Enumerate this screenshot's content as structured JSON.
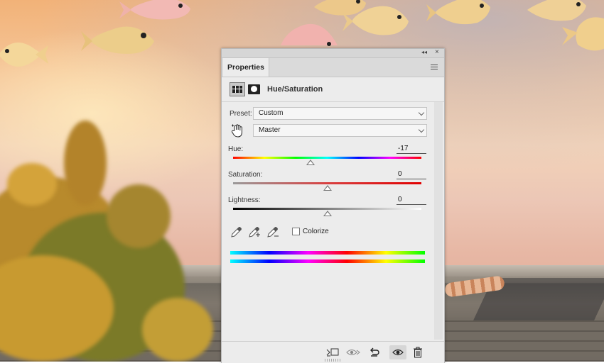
{
  "panel": {
    "tab_label": "Properties",
    "adjustment_title": "Hue/Saturation",
    "preset_label": "Preset:",
    "preset_value": "Custom",
    "channel_value": "Master",
    "colorize_label": "Colorize",
    "colorize_checked": false
  },
  "sliders": [
    {
      "label": "Hue:",
      "value": "-17",
      "position_percent": 41
    },
    {
      "label": "Saturation:",
      "value": "0",
      "position_percent": 50
    },
    {
      "label": "Lightness:",
      "value": "0",
      "position_percent": 50
    }
  ],
  "icons": {
    "collapse": "double-chevron-icon",
    "close": "close-icon",
    "panel_menu": "hamburger-menu-icon",
    "adjustment": "hue-saturation-adjustment-icon",
    "mask": "layer-mask-icon",
    "on_image": "targeted-adjustment-hand-icon",
    "eyedroppers": [
      "eyedropper-icon",
      "eyedropper-plus-icon",
      "eyedropper-minus-icon"
    ],
    "footer": [
      "clip-to-layer-icon",
      "view-previous-state-icon",
      "reset-icon",
      "visibility-eye-icon",
      "trash-icon"
    ]
  },
  "colors": {
    "panel_bg": "#ececec",
    "hue_spectrum": [
      "#ff0000",
      "#ffff00",
      "#00ff00",
      "#00ffff",
      "#0000ff",
      "#ff00ff",
      "#ff0000"
    ],
    "result_spectrum": [
      "#00ffff",
      "#0000ff",
      "#ff00ff",
      "#ff0000",
      "#ffff00",
      "#00ff00"
    ]
  }
}
